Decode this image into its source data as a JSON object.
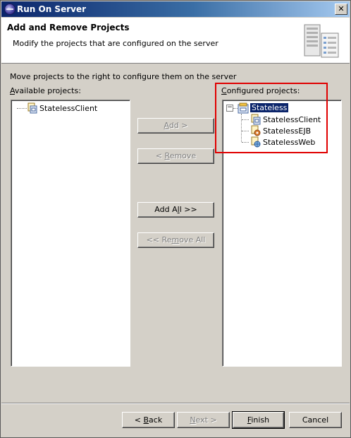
{
  "window": {
    "title": "Run On Server"
  },
  "header": {
    "title": "Add and Remove Projects",
    "description": "Modify the projects that are configured on the server"
  },
  "instruction": "Move projects to the right to configure them on the server",
  "available": {
    "label_mnemonic": "A",
    "label_rest": "vailable projects:",
    "items": [
      "StatelessClient"
    ]
  },
  "configured": {
    "label_mnemonic": "C",
    "label_rest": "onfigured projects:",
    "root": "Stateless",
    "children": [
      "StatelessClient",
      "StatelessEJB",
      "StatelessWeb"
    ]
  },
  "buttons": {
    "add": {
      "pre": "",
      "mnemonic": "A",
      "post": "dd >"
    },
    "remove": {
      "pre": "< ",
      "mnemonic": "R",
      "post": "emove"
    },
    "add_all": {
      "pre": "Add A",
      "mnemonic": "l",
      "post": "l >>"
    },
    "remove_all": {
      "pre": "<< Re",
      "mnemonic": "m",
      "post": "ove All"
    }
  },
  "footer": {
    "back": {
      "pre": "< ",
      "mnemonic": "B",
      "post": "ack"
    },
    "next": {
      "pre": "",
      "mnemonic": "N",
      "post": "ext >"
    },
    "finish": {
      "pre": "",
      "mnemonic": "F",
      "post": "inish"
    },
    "cancel": "Cancel"
  },
  "colors": {
    "title_gradient_start": "#0a246a",
    "title_gradient_end": "#a6caf0",
    "highlight_box": "#e00000",
    "dialog_bg": "#d4d0c8"
  }
}
